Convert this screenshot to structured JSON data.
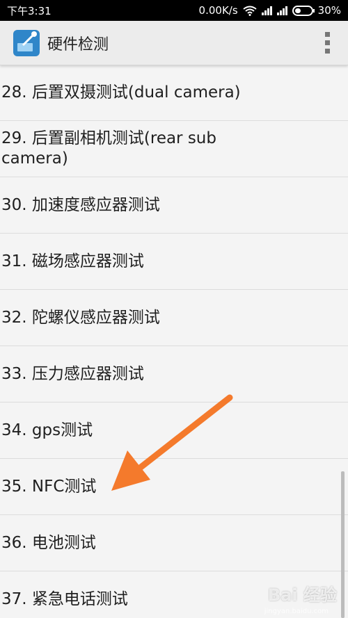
{
  "status_bar": {
    "time": "下午3:31",
    "speed": "0.00K/s",
    "battery": "30%"
  },
  "app_bar": {
    "title": "硬件检测",
    "icon": "hardware-test-app-icon",
    "menu_icon": "overflow-menu-icon"
  },
  "list": {
    "items": [
      {
        "label": "28. 后置双摄测试(dual camera)"
      },
      {
        "label": "29. 后置副相机测试(rear sub camera)"
      },
      {
        "label": "30. 加速度感应器测试"
      },
      {
        "label": "31. 磁场感应器测试"
      },
      {
        "label": "32. 陀螺仪感应器测试"
      },
      {
        "label": "33. 压力感应器测试"
      },
      {
        "label": "34. gps测试"
      },
      {
        "label": "35. NFC测试"
      },
      {
        "label": "36. 电池测试"
      },
      {
        "label": "37. 紧急电话测试"
      }
    ]
  },
  "annotation": {
    "color": "#f47a2c"
  },
  "watermark": {
    "brand": "Bai 经验",
    "domain": "jingyan.baidu.com"
  }
}
